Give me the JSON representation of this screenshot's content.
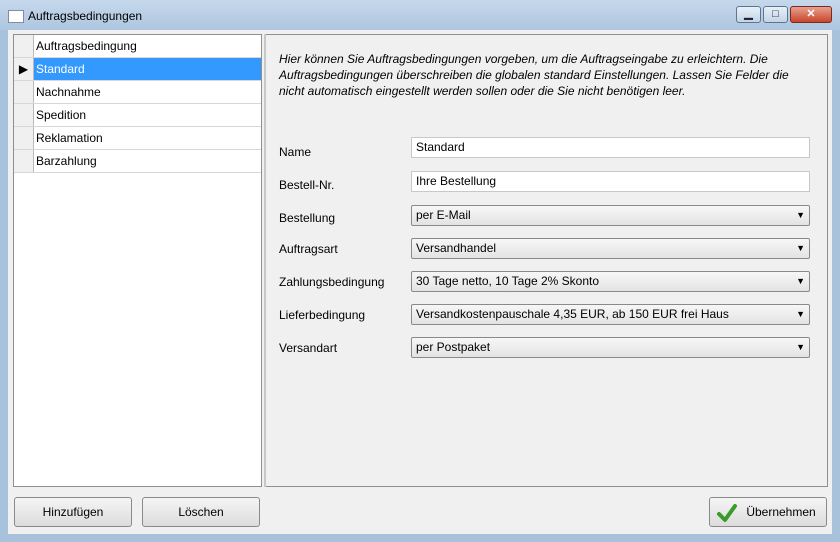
{
  "window": {
    "title": "Auftragsbedingungen",
    "minimize": "▁",
    "maximize": "□",
    "close": "✕"
  },
  "list": {
    "header": "Auftragsbedingung",
    "selected_marker": "▶",
    "items": [
      "Standard",
      "Nachnahme",
      "Spedition",
      "Reklamation",
      "Barzahlung"
    ],
    "selected_index": 0
  },
  "description": "Hier können Sie Auftragsbedingungen vorgeben, um die Auftragseingabe zu erleichtern. Die Auftragsbedingungen überschreiben die globalen standard Einstellungen. Lassen Sie Felder die nicht automatisch eingestellt werden sollen oder die Sie nicht benötigen leer.",
  "form": {
    "name_label": "Name",
    "name_value": "Standard",
    "bestellnr_label": "Bestell-Nr.",
    "bestellnr_value": "Ihre Bestellung",
    "bestellung_label": "Bestellung",
    "bestellung_value": "per E-Mail",
    "auftragsart_label": "Auftragsart",
    "auftragsart_value": "Versandhandel",
    "zahlung_label": "Zahlungsbedingung",
    "zahlung_value": "30 Tage netto, 10 Tage 2% Skonto",
    "liefer_label": "Lieferbedingung",
    "liefer_value": "Versandkostenpauschale 4,35 EUR, ab 150 EUR frei Haus",
    "versandart_label": "Versandart",
    "versandart_value": "per Postpaket"
  },
  "buttons": {
    "add": "Hinzufügen",
    "delete": "Löschen",
    "apply": "Übernehmen"
  },
  "colors": {
    "selection": "#3399ff",
    "check": "#3a9a2a"
  }
}
